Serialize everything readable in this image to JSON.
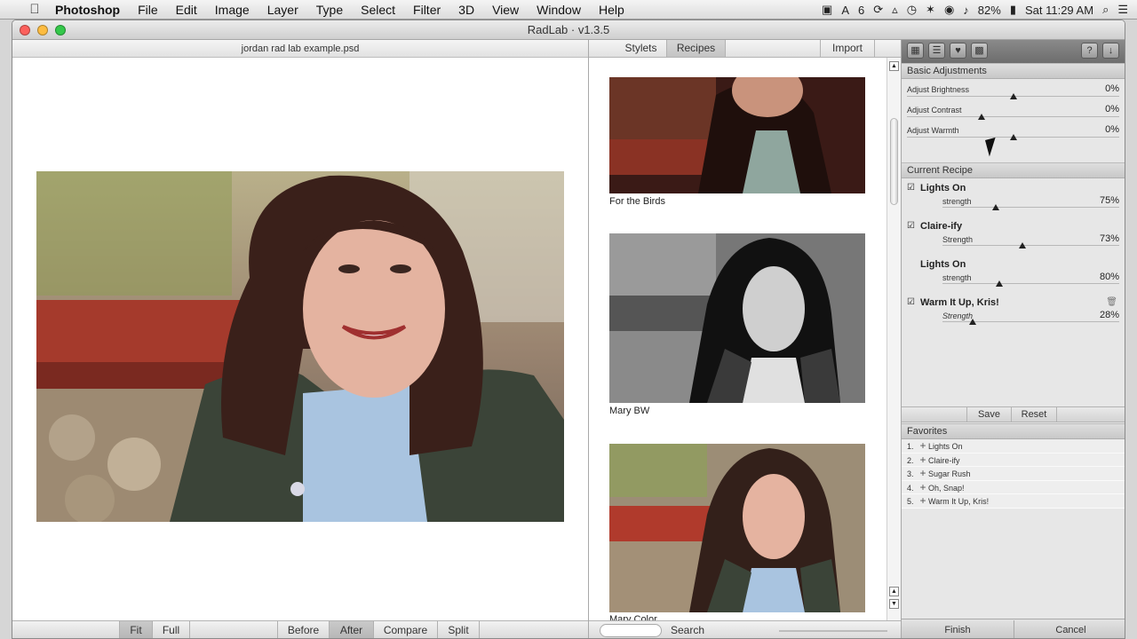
{
  "menubar": {
    "app": "Photoshop",
    "items": [
      "File",
      "Edit",
      "Image",
      "Layer",
      "Type",
      "Select",
      "Filter",
      "3D",
      "View",
      "Window",
      "Help"
    ],
    "status": {
      "adobe_count": "6",
      "battery": "82%",
      "clock": "Sat 11:29 AM"
    }
  },
  "window": {
    "title": "RadLab · v1.3.5"
  },
  "preview": {
    "doc_name": "jordan rad lab example.psd",
    "view_buttons": [
      "Fit",
      "Full"
    ],
    "compare_buttons": [
      "Before",
      "After",
      "Compare",
      "Split"
    ],
    "selected_view": "Fit",
    "selected_compare": "After"
  },
  "styles": {
    "tabs": [
      "Stylets",
      "Recipes"
    ],
    "selected_tab": "Recipes",
    "import_label": "Import",
    "thumbs": [
      {
        "label": "For the Birds"
      },
      {
        "label": "Mary BW"
      },
      {
        "label": "Mary Color"
      }
    ],
    "search_label": "Search"
  },
  "panel": {
    "basic": {
      "title": "Basic Adjustments",
      "items": [
        {
          "label": "Adjust Brightness",
          "value": "0%",
          "pos": 0.5
        },
        {
          "label": "Adjust Contrast",
          "value": "0%",
          "pos": 0.35
        },
        {
          "label": "Adjust Warmth",
          "value": "0%",
          "pos": 0.5
        }
      ]
    },
    "recipe": {
      "title": "Current Recipe",
      "items": [
        {
          "name": "Lights On",
          "checked": true,
          "strength_label": "strength",
          "value": "75%",
          "pos": 0.3
        },
        {
          "name": "Claire-ify",
          "checked": true,
          "strength_label": "Strength",
          "value": "73%",
          "pos": 0.45
        },
        {
          "name": "Lights On",
          "checked": false,
          "strength_label": "strength",
          "value": "80%",
          "pos": 0.32
        },
        {
          "name": "Warm It Up, Kris!",
          "checked": true,
          "strength_label": "Strength",
          "value": "28%",
          "pos": 0.17
        }
      ],
      "save_label": "Save",
      "reset_label": "Reset"
    },
    "favorites": {
      "title": "Favorites",
      "items": [
        "Lights On",
        "Claire-ify",
        "Sugar Rush",
        "Oh, Snap!",
        "Warm It Up, Kris!"
      ]
    },
    "finish_label": "Finish",
    "cancel_label": "Cancel",
    "help_label": "?"
  },
  "colors": {
    "accent": "#c4c4c4",
    "panel_header": "#cfcfcf"
  }
}
